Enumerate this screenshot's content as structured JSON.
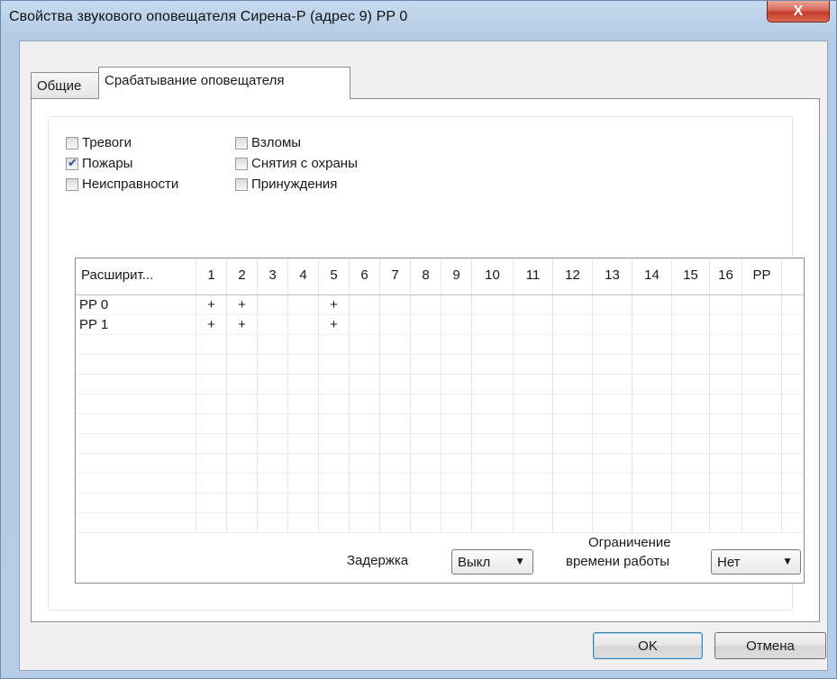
{
  "window": {
    "title": "Свойства звукового оповещателя Сирена-Р (адрес 9) PP 0",
    "close_label": "X"
  },
  "tabs": [
    {
      "label": "Общие",
      "active": false
    },
    {
      "label": "Срабатывание оповещателя",
      "active": true
    }
  ],
  "checkboxes": [
    {
      "label": "Тревоги",
      "checked": false
    },
    {
      "label": "Пожары",
      "checked": true
    },
    {
      "label": "Неисправности",
      "checked": false
    },
    {
      "label": "Взломы",
      "checked": false
    },
    {
      "label": "Снятия с охраны",
      "checked": false
    },
    {
      "label": "Принуждения",
      "checked": false
    }
  ],
  "grid": {
    "columns": [
      "Расширит...",
      "1",
      "2",
      "3",
      "4",
      "5",
      "6",
      "7",
      "8",
      "9",
      "10",
      "11",
      "12",
      "13",
      "14",
      "15",
      "16",
      "PP"
    ],
    "rows": [
      [
        "PP 0",
        "+",
        "+",
        "",
        "",
        "+",
        "",
        "",
        "",
        "",
        "",
        "",
        "",
        "",
        "",
        "",
        "",
        ""
      ],
      [
        "PP 1",
        "+",
        "+",
        "",
        "",
        "+",
        "",
        "",
        "",
        "",
        "",
        "",
        "",
        "",
        "",
        "",
        "",
        ""
      ]
    ],
    "empty_rows": 10
  },
  "delay": {
    "label": "Задержка",
    "value": "Выкл"
  },
  "limit": {
    "label_line1": "Ограничение",
    "label_line2": "времени работы",
    "value": "Нет"
  },
  "buttons": {
    "ok": "OK",
    "cancel": "Отмена"
  },
  "colors": {
    "checkmark": "#2b4f9e",
    "close_button": "#c43a2c",
    "frame": "#b7cde5"
  }
}
